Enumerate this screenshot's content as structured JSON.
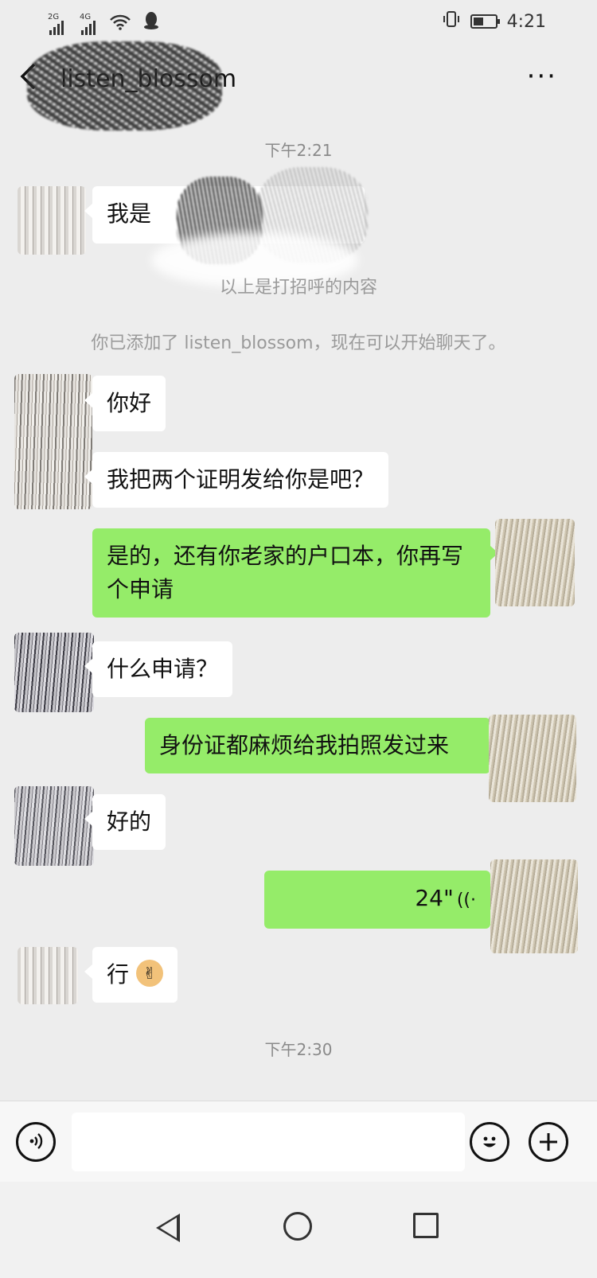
{
  "status_bar": {
    "signal1_label": "2G",
    "signal2_label": "4G",
    "time": "4:21"
  },
  "header": {
    "contact_name": "listen_blossom",
    "back_icon": "chevron-left-icon",
    "more_icon": "more-dots-icon",
    "more_label": "···"
  },
  "chat": {
    "time1": "下午2:21",
    "greeting_text": "我是",
    "greeting_note": "以上是打招呼的内容",
    "added_notice": "你已添加了 listen_blossom，现在可以开始聊天了。",
    "messages": [
      {
        "side": "in",
        "text": "你好"
      },
      {
        "side": "in",
        "text": "我把两个证明发给你是吧？"
      },
      {
        "side": "out",
        "text": "是的，还有你老家的户口本，你再写个申请"
      },
      {
        "side": "in",
        "text": "什么申请？"
      },
      {
        "side": "out",
        "text": "身份证都麻烦给我拍照发过来"
      },
      {
        "side": "in",
        "text": "好的"
      },
      {
        "side": "out",
        "text": "24\"",
        "type": "voice"
      },
      {
        "side": "in",
        "text": "行",
        "emoji": "ok-hand"
      }
    ],
    "time2": "下午2:30"
  },
  "input_bar": {
    "voice_icon": "voice-icon",
    "emoji_icon": "emoji-icon",
    "plus_icon": "plus-icon"
  },
  "nav_bar": {
    "back": "triangle-back-icon",
    "home": "circle-home-icon",
    "recent": "square-recent-icon"
  },
  "colors": {
    "background": "#ededed",
    "bubble_out": "#95ec69",
    "bubble_in": "#ffffff"
  }
}
